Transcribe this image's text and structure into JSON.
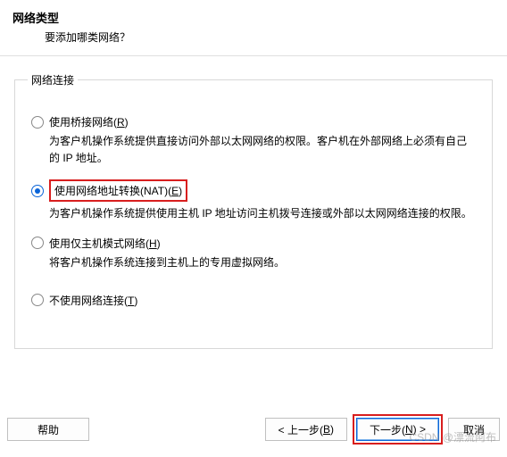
{
  "header": {
    "title": "网络类型",
    "subtitle": "要添加哪类网络？"
  },
  "fieldset_legend": "网络连接",
  "options": {
    "bridged": {
      "label_pre": "使用桥接网络(",
      "mn": "R",
      "label_post": ")",
      "desc": "为客户机操作系统提供直接访问外部以太网网络的权限。客户机在外部网络上必须有自己的 IP 地址。"
    },
    "nat": {
      "label_pre": "使用网络地址转换(NAT)(",
      "mn": "E",
      "label_post": ")",
      "desc": "为客户机操作系统提供使用主机 IP 地址访问主机拨号连接或外部以太网网络连接的权限。",
      "selected": true
    },
    "hostonly": {
      "label_pre": "使用仅主机模式网络(",
      "mn": "H",
      "label_post": ")",
      "desc": "将客户机操作系统连接到主机上的专用虚拟网络。"
    },
    "none": {
      "label_pre": "不使用网络连接(",
      "mn": "T",
      "label_post": ")"
    }
  },
  "buttons": {
    "help": "帮助",
    "back_pre": "< 上一步(",
    "back_mn": "B",
    "back_post": ")",
    "next_pre": "下一步(",
    "next_mn": "N",
    "next_post": ") >",
    "cancel": "取消"
  },
  "watermark": "CSDN @漂流阿布"
}
